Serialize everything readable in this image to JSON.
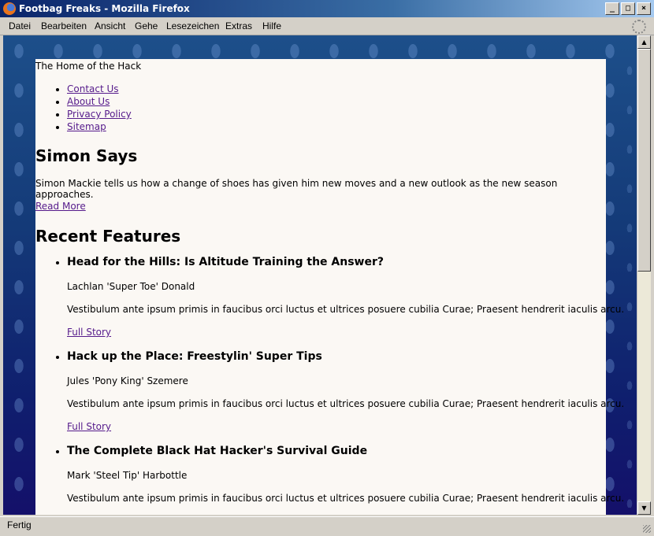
{
  "window": {
    "title": "Footbag Freaks - Mozilla Firefox"
  },
  "menu": [
    "Datei",
    "Bearbeiten",
    "Ansicht",
    "Gehe",
    "Lesezeichen",
    "Extras",
    "Hilfe"
  ],
  "page": {
    "tagline": "The Home of the Hack",
    "nav": [
      "Contact Us",
      "About Us",
      "Privacy Policy",
      "Sitemap"
    ],
    "feature_heading": "Simon Says",
    "feature_text": "Simon Mackie tells us how a change of shoes has given him new moves and a new outlook as the new season approaches.",
    "feature_link": "Read More",
    "recent_heading": "Recent Features",
    "articles": [
      {
        "title": "Head for the Hills: Is Altitude Training the Answer?",
        "author": "Lachlan 'Super Toe' Donald",
        "desc": "Vestibulum ante ipsum primis in faucibus orci luctus et ultrices posuere cubilia Curae; Praesent hendrerit iaculis arcu.",
        "link": "Full Story"
      },
      {
        "title": "Hack up the Place: Freestylin' Super Tips",
        "author": "Jules 'Pony King' Szemere",
        "desc": "Vestibulum ante ipsum primis in faucibus orci luctus et ultrices posuere cubilia Curae; Praesent hendrerit iaculis arcu.",
        "link": "Full Story"
      },
      {
        "title": "The Complete Black Hat Hacker's Survival Guide",
        "author": "Mark 'Steel Tip' Harbottle",
        "desc": "Vestibulum ante ipsum primis in faucibus orci luctus et ultrices posuere cubilia Curae; Praesent hendrerit iaculis arcu.",
        "link": ""
      }
    ]
  },
  "status": {
    "text": "Fertig"
  },
  "icons": {
    "browser": "firefox-logo-icon",
    "throbber": "throbber-icon",
    "grip": "resize-grip-icon"
  }
}
